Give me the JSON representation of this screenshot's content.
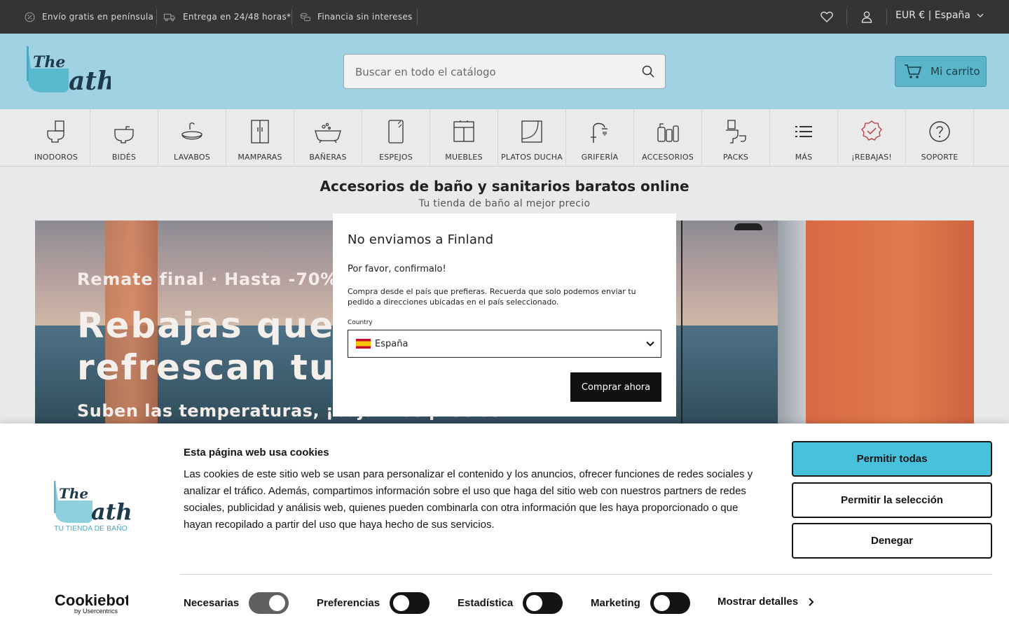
{
  "topbar": {
    "perks": [
      {
        "icon": "percent-icon",
        "label": "Envío gratis en península"
      },
      {
        "icon": "truck-icon",
        "label": "Entrega en 24/48 horas*"
      },
      {
        "icon": "coins-icon",
        "label": "Financia sin intereses"
      }
    ],
    "locale": "EUR € | España"
  },
  "header": {
    "search_placeholder": "Buscar en todo el catálogo",
    "cart_label": "Mi carrito"
  },
  "categories": [
    {
      "label": "INODOROS",
      "icon": "toilet-icon"
    },
    {
      "label": "BIDÉS",
      "icon": "bidet-icon"
    },
    {
      "label": "LAVABOS",
      "icon": "sink-icon"
    },
    {
      "label": "MAMPARAS",
      "icon": "shower-screen-icon"
    },
    {
      "label": "BAÑERAS",
      "icon": "bathtub-icon"
    },
    {
      "label": "ESPEJOS",
      "icon": "mirror-icon"
    },
    {
      "label": "MUEBLES",
      "icon": "cabinet-icon"
    },
    {
      "label": "PLATOS DUCHA",
      "icon": "shower-tray-icon"
    },
    {
      "label": "GRIFERÍA",
      "icon": "faucet-icon"
    },
    {
      "label": "ACCESORIOS",
      "icon": "accessories-icon"
    },
    {
      "label": "PACKS",
      "icon": "pack-icon"
    },
    {
      "label": "MÁS",
      "icon": "list-icon"
    },
    {
      "label": "¡REBAJAS!",
      "icon": "sale-badge-icon"
    },
    {
      "label": "SOPORTE",
      "icon": "help-icon"
    }
  ],
  "page": {
    "headline": "Accesorios de baño y sanitarios baratos online",
    "subline": "Tu tienda de baño al mejor precio"
  },
  "hero": {
    "kicker": "Remate final · Hasta -70%",
    "title": "Rebajas que\nrefrescan tu b",
    "subtitle": "Suben las temperaturas, ¡bajan los precios!"
  },
  "modal": {
    "title": "No enviamos a Finland",
    "confirm": "Por favor, confirmalo!",
    "description": "Compra desde el país que prefieras. Recuerda que solo podemos enviar tu pedido a direcciones ubicadas en el país seleccionado.",
    "country_label": "Country",
    "country_value": "España",
    "button": "Comprar ahora"
  },
  "cookies": {
    "title": "Esta página web usa cookies",
    "text": "Las cookies de este sitio web se usan para personalizar el contenido y los anuncios, ofrecer funciones de redes sociales y analizar el tráfico. Además, compartimos información sobre el uso que haga del sitio web con nuestros partners de redes sociales, publicidad y análisis web, quienes pueden combinarla con otra información que les haya proporcionado o que hayan recopilado a partir del uso que haya hecho de sus servicios.",
    "allow_all": "Permitir todas",
    "allow_selection": "Permitir la selección",
    "deny": "Denegar",
    "toggles": [
      {
        "label": "Necesarias",
        "on": true
      },
      {
        "label": "Preferencias",
        "on": false
      },
      {
        "label": "Estadística",
        "on": false
      },
      {
        "label": "Marketing",
        "on": false
      }
    ],
    "show_details": "Mostrar detalles",
    "logo_tagline": "TU TIENDA DE BAÑO",
    "provider_logo": "Cookiebot",
    "provider_sub": "by Usercentrics"
  },
  "brand": {
    "logo_text_1": "The",
    "logo_text_2": "ath",
    "accent": "#48c2dc",
    "header_bg": "#9fd2e2",
    "topbar_bg": "#343434"
  }
}
